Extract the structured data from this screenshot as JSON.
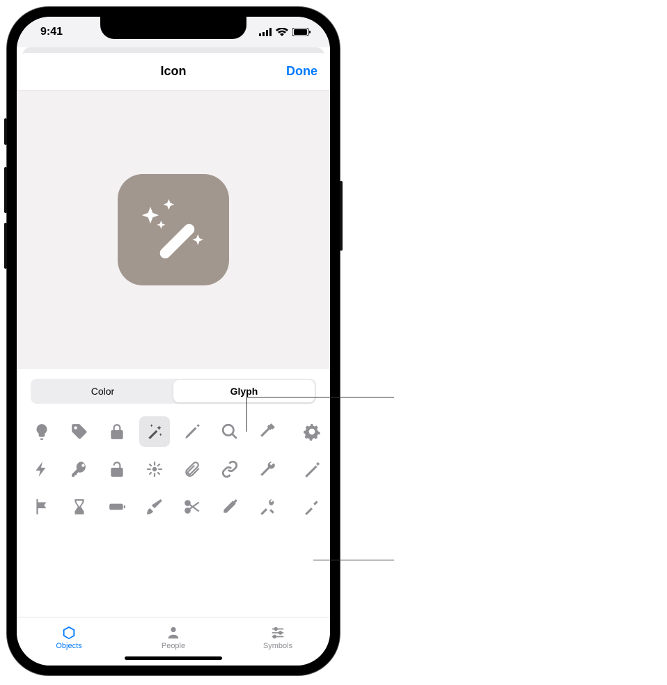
{
  "status": {
    "time": "9:41"
  },
  "nav": {
    "title": "Icon",
    "done": "Done"
  },
  "preview": {
    "glyph_name": "magic-wand-icon",
    "bg_color": "#a2978f"
  },
  "segmented": {
    "options": [
      "Color",
      "Glyph"
    ],
    "selected": "Glyph"
  },
  "glyphs": {
    "rows": [
      [
        "lightbulb",
        "tag",
        "lock",
        "magic-wand",
        "pencil",
        "search",
        "hammer",
        "gear"
      ],
      [
        "bolt",
        "key",
        "unlock",
        "sparkle-burst",
        "paperclip",
        "link",
        "wrench",
        "wand-alt"
      ],
      [
        "flag",
        "hourglass",
        "battery",
        "brush",
        "scissors",
        "eyedropper",
        "tools",
        "screwdriver"
      ]
    ],
    "selected": "magic-wand"
  },
  "tabs": {
    "items": [
      {
        "label": "Objects",
        "icon": "cube-icon"
      },
      {
        "label": "People",
        "icon": "person-icon"
      },
      {
        "label": "Symbols",
        "icon": "sliders-icon"
      }
    ],
    "active": "Objects"
  }
}
